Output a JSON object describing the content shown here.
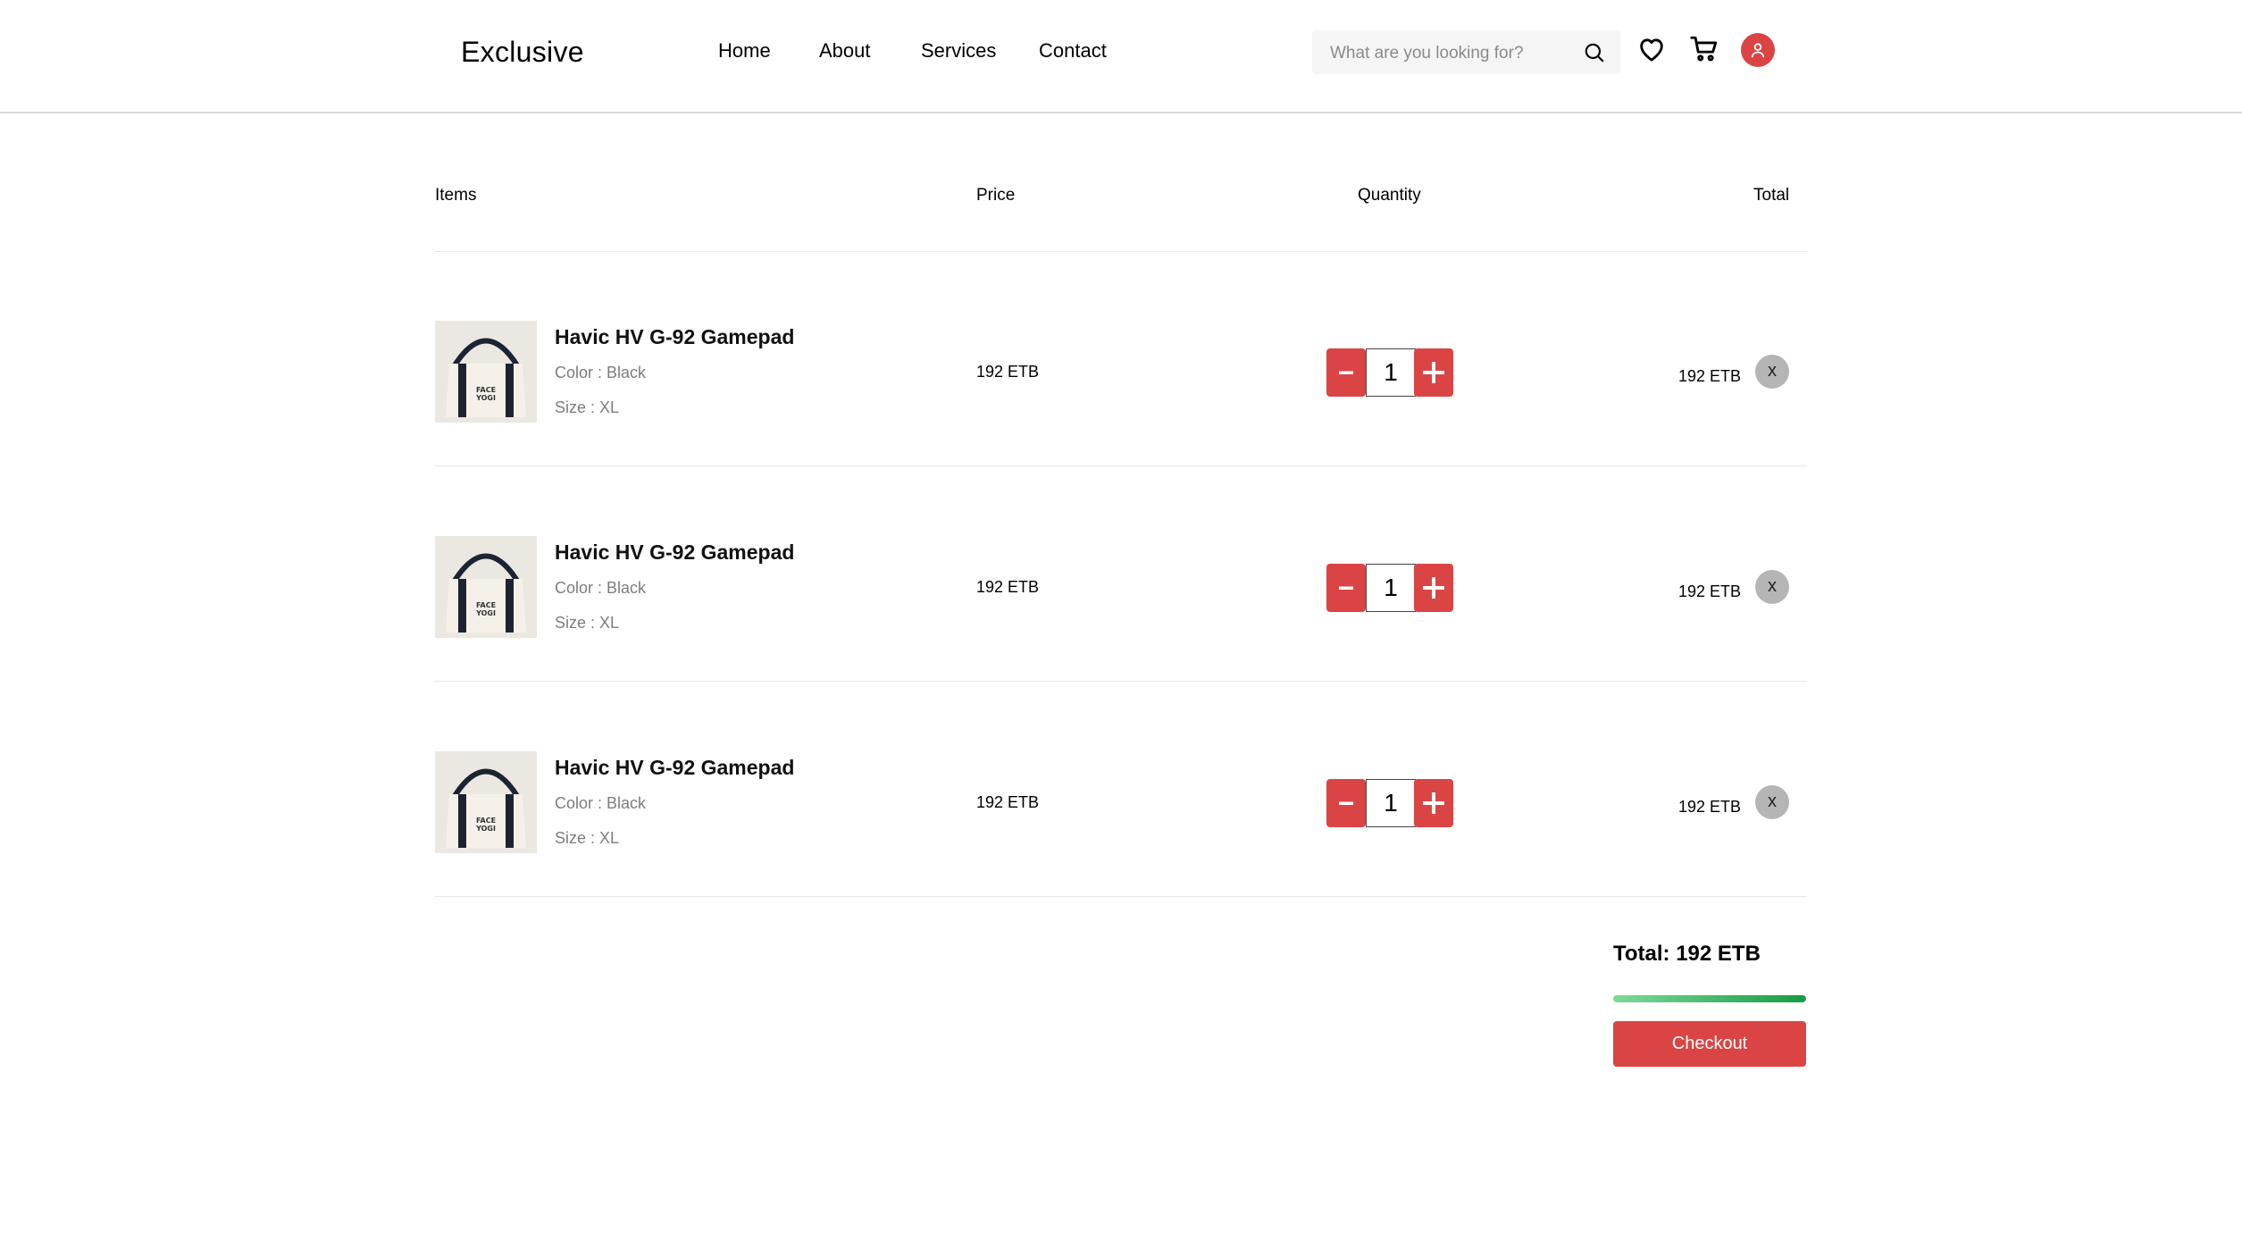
{
  "header": {
    "logo": "Exclusive",
    "nav": [
      "Home",
      "About",
      "Services",
      "Contact"
    ],
    "search_placeholder": "What are you looking for?",
    "icons": [
      "search-icon",
      "heart-icon",
      "cart-icon",
      "user-icon"
    ]
  },
  "table": {
    "headers": {
      "items": "Items",
      "price": "Price",
      "quantity": "Quantity",
      "total": "Total"
    },
    "rows": [
      {
        "name": "Havic HV G-92 Gamepad",
        "color": "Color : Black",
        "size": "Size : XL",
        "price": "192 ETB",
        "quantity": "1",
        "total": "192 ETB",
        "remove": "x"
      },
      {
        "name": "Havic HV G-92 Gamepad",
        "color": "Color : Black",
        "size": "Size : XL",
        "price": "192 ETB",
        "quantity": "1",
        "total": "192 ETB",
        "remove": "x"
      },
      {
        "name": "Havic HV G-92 Gamepad",
        "color": "Color : Black",
        "size": "Size : XL",
        "price": "192 ETB",
        "quantity": "1",
        "total": "192 ETB",
        "remove": "x"
      }
    ]
  },
  "summary": {
    "total": "Total: 192 ETB",
    "progress": 1.0,
    "checkout": "Checkout"
  },
  "colors": {
    "accent": "#db4444",
    "progress_start": "#7ed99a",
    "progress_end": "#169b43",
    "remove_bg": "#b5b5b5"
  }
}
